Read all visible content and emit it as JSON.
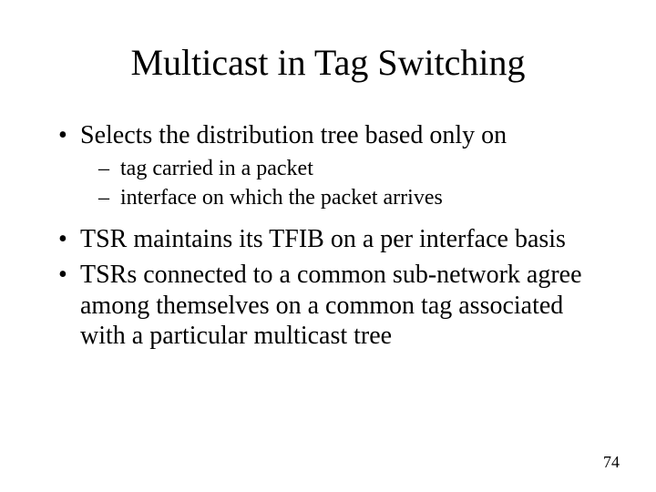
{
  "title": "Multicast in Tag Switching",
  "bullets": [
    {
      "text": "Selects the distribution tree based only on",
      "sub": [
        "tag carried in a packet",
        "interface on which the packet arrives"
      ]
    },
    {
      "text": "TSR maintains its TFIB on a per interface basis",
      "sub": []
    },
    {
      "text": "TSRs connected to a common sub-network agree among themselves on a common tag associated with a particular multicast tree",
      "sub": []
    }
  ],
  "page_number": "74"
}
